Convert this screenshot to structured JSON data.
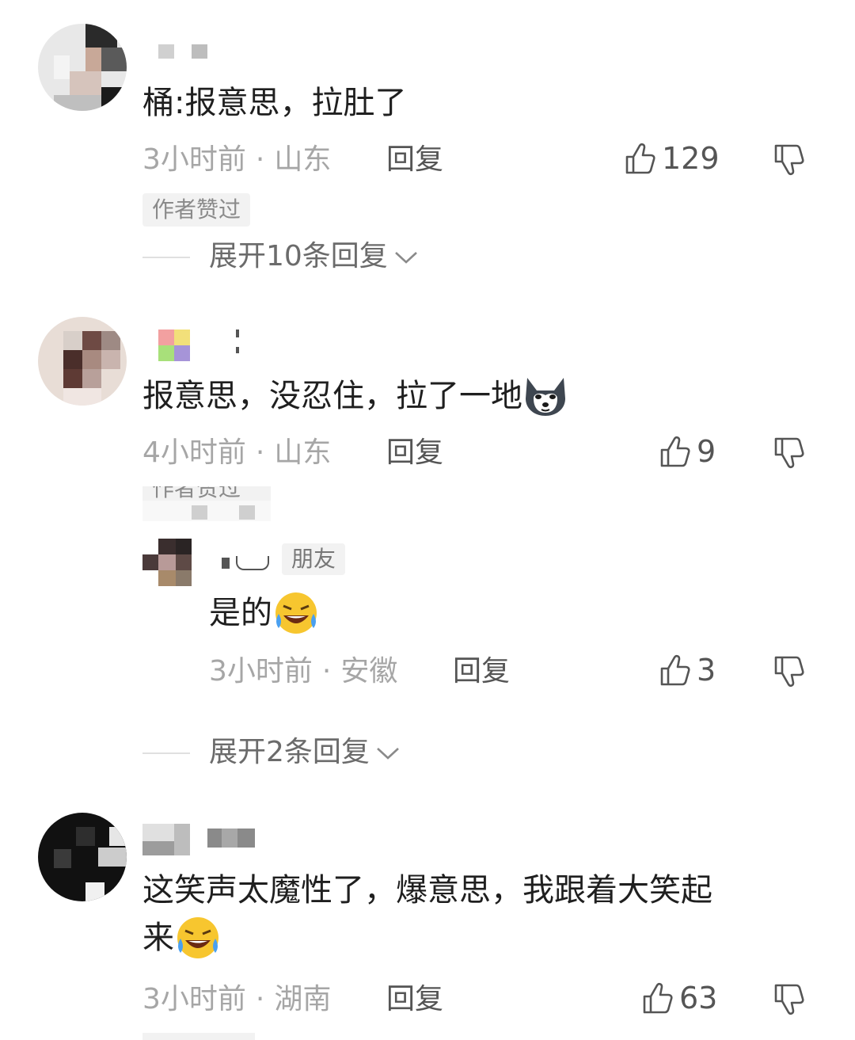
{
  "comments": [
    {
      "content": "桶:报意思，拉肚了",
      "time": "3小时前",
      "location": "山东",
      "reply_label": "回复",
      "likes": "129",
      "author_tag": "作者赞过",
      "expand_label": "展开10条回复"
    },
    {
      "content": "报意思，没忍住，拉了一地",
      "content_emoji": "husky-emoji",
      "time": "4小时前",
      "location": "山东",
      "reply_label": "回复",
      "likes": "9",
      "author_tag_partial": "作者赞过",
      "reply": {
        "name_tag": "朋友",
        "content": "是的",
        "content_emoji": "rofl-emoji",
        "time": "3小时前",
        "location": "安徽",
        "reply_label": "回复",
        "likes": "3"
      },
      "expand_label": "展开2条回复"
    },
    {
      "content_line1": "这笑声太魔性了，爆意思，我跟着大笑起",
      "content_line2": "来",
      "content_emoji": "rofl-emoji",
      "time": "3小时前",
      "location": "湖南",
      "reply_label": "回复",
      "likes": "63"
    }
  ],
  "separator": "·",
  "icons": {
    "like": "thumbs-up-icon",
    "dislike": "thumbs-down-icon",
    "expand": "chevron-down-icon"
  },
  "colors": {
    "text": "#1f1f1f",
    "meta": "#a6a6a6",
    "tag_bg": "#f2f2f2"
  }
}
